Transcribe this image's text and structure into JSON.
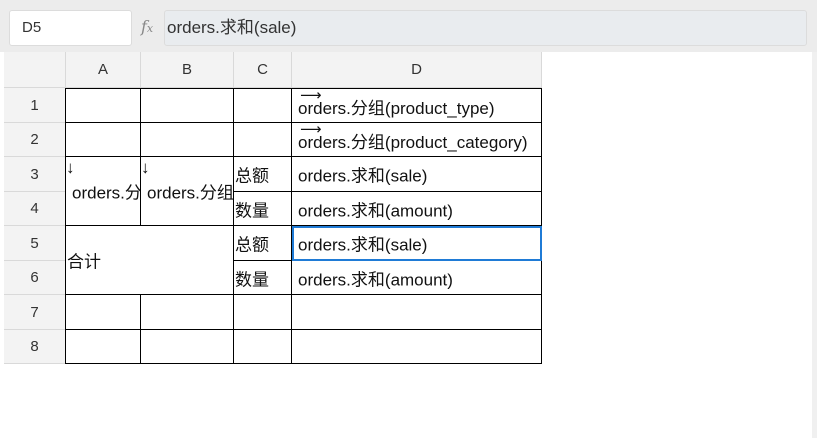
{
  "formula_bar": {
    "name_box": "D5",
    "fx_icon": "function-icon",
    "formula": "orders.求和(sale)"
  },
  "columns": [
    "A",
    "B",
    "C",
    "D"
  ],
  "rows": [
    "1",
    "2",
    "3",
    "4",
    "5",
    "6",
    "7",
    "8"
  ],
  "cells": {
    "D1": "orders.分组(product_type)",
    "D2": "orders.分组(product_category)",
    "A3": "orders.分组",
    "B3": "orders.分组",
    "C3": "总额",
    "D3": "orders.求和(sale)",
    "C4": "数量",
    "D4": "orders.求和(amount)",
    "A5": "合计",
    "C5": "总额",
    "D5": "orders.求和(sale)",
    "C6": "数量",
    "D6": "orders.求和(amount)"
  },
  "selected_cell": "D5"
}
